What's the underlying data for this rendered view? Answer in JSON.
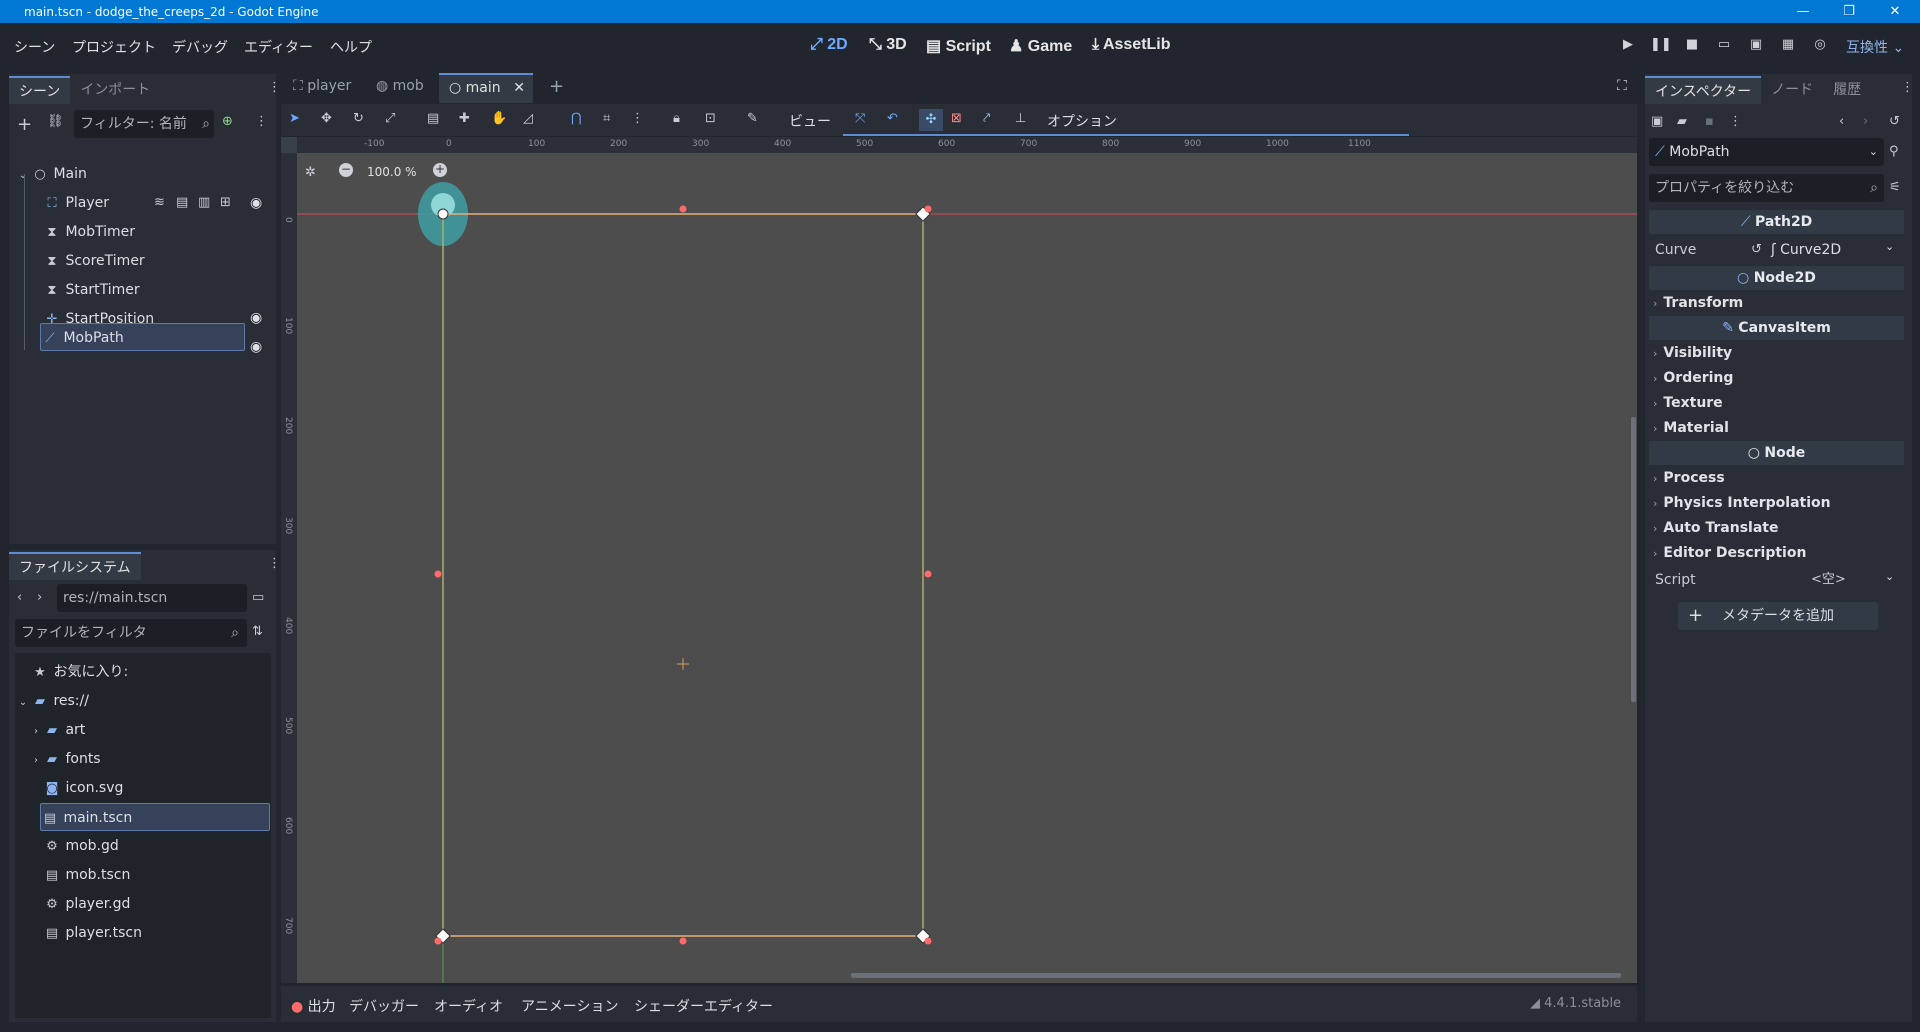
{
  "window": {
    "title": "main.tscn - dodge_the_creeps_2d - Godot Engine",
    "minimize": "—",
    "maximize": "❐",
    "close": "✕"
  },
  "menu": {
    "items": [
      "シーン",
      "プロジェクト",
      "デバッグ",
      "エディター",
      "ヘルプ"
    ],
    "modes": [
      "2D",
      "3D",
      "Script",
      "Game",
      "AssetLib"
    ],
    "active_mode": "2D",
    "renderer": "互換性"
  },
  "scene_dock": {
    "tabs": [
      "シーン",
      "インポート"
    ],
    "filter_placeholder": "フィルター: 名前",
    "nodes": [
      {
        "label": "Main",
        "icon": "node-icon"
      },
      {
        "label": "Player",
        "icon": "area2d-icon"
      },
      {
        "label": "MobTimer",
        "icon": "timer-icon"
      },
      {
        "label": "ScoreTimer",
        "icon": "timer-icon"
      },
      {
        "label": "StartTimer",
        "icon": "timer-icon"
      },
      {
        "label": "StartPosition",
        "icon": "marker-icon"
      },
      {
        "label": "MobPath",
        "icon": "path-icon"
      }
    ]
  },
  "filesystem": {
    "title": "ファイルシステム",
    "path": "res://main.tscn",
    "filter_placeholder": "ファイルをフィルタ",
    "favorites": "お気に入り:",
    "root": "res://",
    "items": [
      {
        "label": "art",
        "type": "folder"
      },
      {
        "label": "fonts",
        "type": "folder"
      },
      {
        "label": "icon.svg",
        "type": "image"
      },
      {
        "label": "main.tscn",
        "type": "scene"
      },
      {
        "label": "mob.gd",
        "type": "script"
      },
      {
        "label": "mob.tscn",
        "type": "scene"
      },
      {
        "label": "player.gd",
        "type": "script"
      },
      {
        "label": "player.tscn",
        "type": "scene"
      }
    ]
  },
  "editor_tabs": [
    "player",
    "mob",
    "main"
  ],
  "active_editor_tab": "main",
  "toolbar": {
    "view_label": "ビュー",
    "options_label": "オプション"
  },
  "viewport": {
    "zoom": "100.0 %",
    "ruler_x_labels": [
      "-100",
      "0",
      "100",
      "200",
      "300",
      "400",
      "500",
      "600",
      "700",
      "800",
      "900",
      "1000",
      "1100"
    ],
    "ruler_y_labels": [
      "0",
      "100",
      "200",
      "300",
      "400",
      "500",
      "600",
      "700"
    ]
  },
  "inspector": {
    "tabs": [
      "インスペクター",
      "ノード",
      "履歴"
    ],
    "selected_node": "MobPath",
    "filter_placeholder": "プロパティを絞り込む",
    "sections": {
      "path2d": "Path2D",
      "node2d": "Node2D",
      "canvasitem": "CanvasItem",
      "node": "Node"
    },
    "curve_label": "Curve",
    "curve_value": "Curve2D",
    "node2d_props": [
      "Transform"
    ],
    "canvasitem_props": [
      "Visibility",
      "Ordering",
      "Texture",
      "Material"
    ],
    "node_props": [
      "Process",
      "Physics Interpolation",
      "Auto Translate",
      "Editor Description"
    ],
    "script_label": "Script",
    "script_value": "<空>",
    "add_metadata": "メタデータを追加"
  },
  "bottom_panel": {
    "tabs": [
      "出力",
      "デバッガー",
      "オーディオ",
      "アニメーション",
      "シェーダーエディター"
    ],
    "version": "4.4.1.stable"
  }
}
